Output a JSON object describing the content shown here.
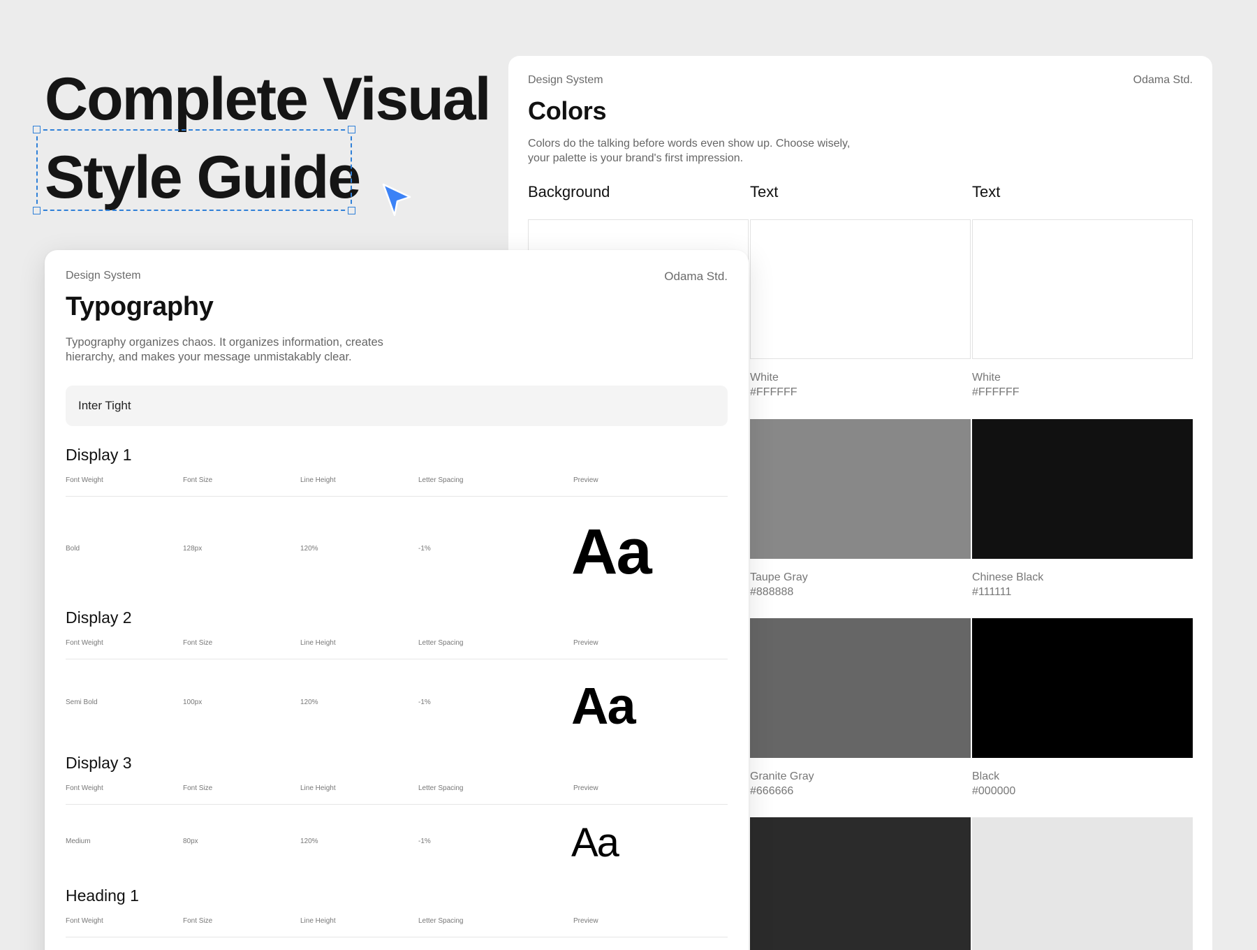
{
  "hero": {
    "line1": "Complete Visual",
    "line2": "Style Guide"
  },
  "colors_card": {
    "label": "Design System",
    "brand": "Odama Std.",
    "title": "Colors",
    "description_line1": "Colors do the talking before words even show up. Choose wisely,",
    "description_line2": "your palette is your brand's first impression.",
    "columns": [
      "Background",
      "Text",
      "Text"
    ],
    "swatches": [
      {
        "name": "White",
        "hex": "#FFFFFF",
        "color": "#FFFFFF"
      },
      {
        "name": "White",
        "hex": "#FFFFFF",
        "color": "#FFFFFF"
      },
      {
        "name": "Taupe Gray",
        "hex": "#888888",
        "color": "#888888"
      },
      {
        "name": "Chinese Black",
        "hex": "#111111",
        "color": "#111111"
      },
      {
        "name": "Granite Gray",
        "hex": "#666666",
        "color": "#666666"
      },
      {
        "name": "Black",
        "hex": "#000000",
        "color": "#000000"
      },
      {
        "color": "#2b2b2b"
      },
      {
        "color": "#e6e6e6"
      }
    ]
  },
  "type_card": {
    "label": "Design System",
    "brand": "Odama Std.",
    "title": "Typography",
    "description_line1": "Typography organizes chaos. It organizes information, creates",
    "description_line2": "hierarchy, and makes your message unmistakably clear.",
    "font_name": "Inter Tight",
    "column_labels": [
      "Font Weight",
      "Font Size",
      "Line Height",
      "Letter Spacing",
      "Preview"
    ],
    "styles": [
      {
        "name": "Display 1",
        "weight": "Bold",
        "size": "128px",
        "line_height": "120%",
        "letter_spacing": "-1%",
        "preview": "Aa"
      },
      {
        "name": "Display 2",
        "weight": "Semi Bold",
        "size": "100px",
        "line_height": "120%",
        "letter_spacing": "-1%",
        "preview": "Aa"
      },
      {
        "name": "Display 3",
        "weight": "Medium",
        "size": "80px",
        "line_height": "120%",
        "letter_spacing": "-1%",
        "preview": "Aa"
      },
      {
        "name": "Heading 1"
      }
    ]
  }
}
